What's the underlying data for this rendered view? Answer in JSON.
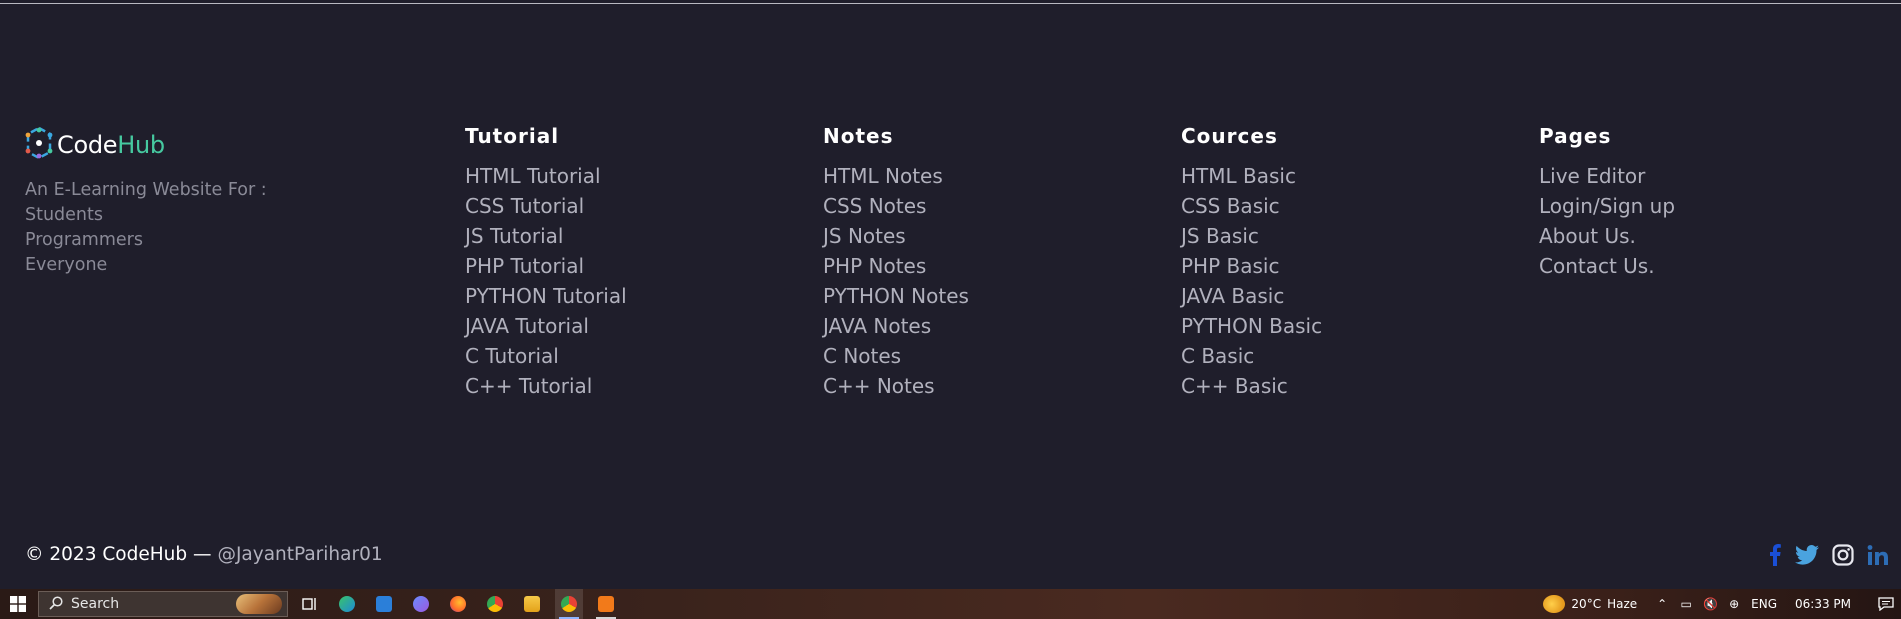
{
  "brand": {
    "logo_text_main": "Code",
    "logo_text_accent": "Hub",
    "tagline": [
      "An E-Learning Website For :",
      "Students",
      "Programmers",
      "Everyone"
    ]
  },
  "columns": [
    {
      "heading": "Tutorial",
      "links": [
        "HTML Tutorial",
        "CSS Tutorial",
        "JS Tutorial",
        "PHP Tutorial",
        "PYTHON Tutorial",
        "JAVA Tutorial",
        "C Tutorial",
        "C++ Tutorial"
      ]
    },
    {
      "heading": "Notes",
      "links": [
        "HTML Notes",
        "CSS Notes",
        "JS Notes",
        "PHP Notes",
        "PYTHON Notes",
        "JAVA Notes",
        "C Notes",
        "C++ Notes"
      ]
    },
    {
      "heading": "Cources",
      "links": [
        "HTML Basic",
        "CSS Basic",
        "JS Basic",
        "PHP Basic",
        "JAVA Basic",
        "PYTHON Basic",
        "C Basic",
        "C++ Basic"
      ]
    },
    {
      "heading": "Pages",
      "links": [
        "Live Editor",
        "Login/Sign up",
        "About Us.",
        "Contact Us."
      ]
    }
  ],
  "footer": {
    "copyright": "© 2023 CodeHub —",
    "handle": "@JayantParihar01",
    "socials": [
      "facebook-icon",
      "twitter-icon",
      "instagram-icon",
      "linkedin-icon"
    ]
  },
  "taskbar": {
    "search_placeholder": "Search",
    "weather_temp": "20°C",
    "weather_desc": "Haze",
    "language": "ENG",
    "time": "06:33 PM"
  },
  "colors": {
    "background": "#1f1e2b",
    "accent": "#46c9a0",
    "link": "#b1b1bd"
  }
}
